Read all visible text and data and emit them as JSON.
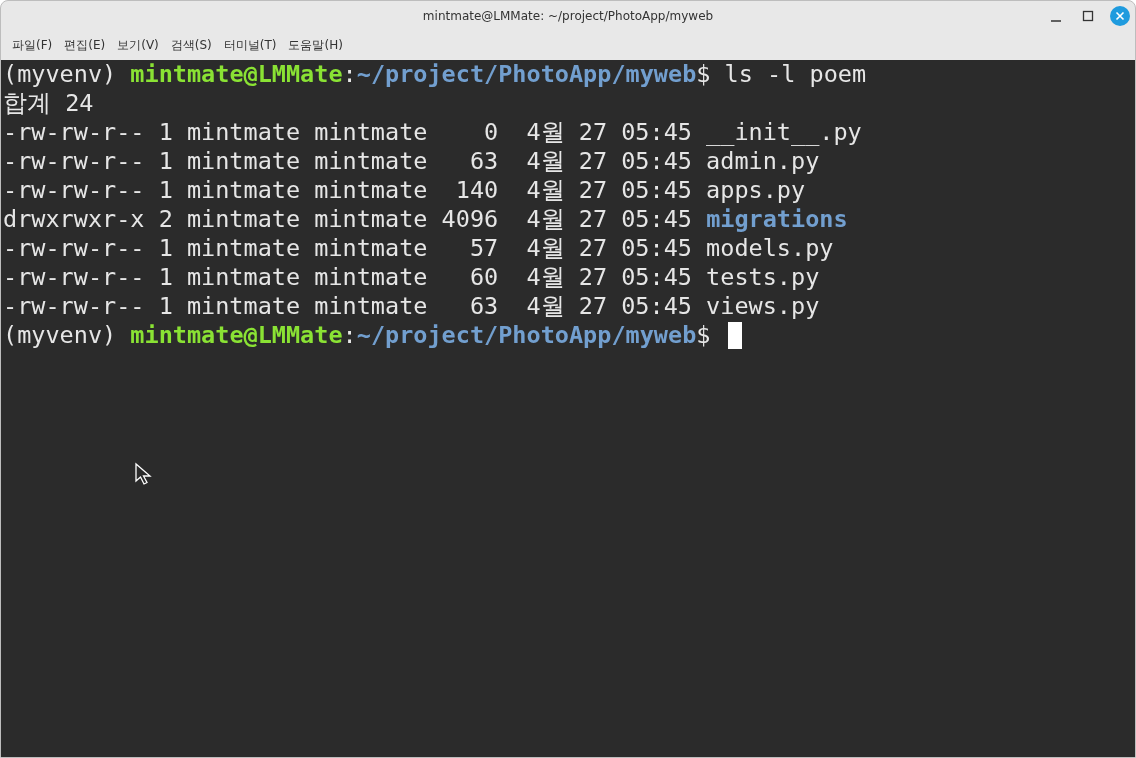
{
  "window": {
    "title": "mintmate@LMMate: ~/project/PhotoApp/myweb"
  },
  "menu": [
    {
      "label": "파일(F)"
    },
    {
      "label": "편집(E)"
    },
    {
      "label": "보기(V)"
    },
    {
      "label": "검색(S)"
    },
    {
      "label": "터미널(T)"
    },
    {
      "label": "도움말(H)"
    }
  ],
  "terminal": {
    "lines": [
      {
        "segments": [
          {
            "kind": "plain",
            "text": "(myvenv) "
          },
          {
            "kind": "user",
            "text": "mintmate@LMMate"
          },
          {
            "kind": "plain",
            "text": ":"
          },
          {
            "kind": "path",
            "text": "~/project/PhotoApp/myweb"
          },
          {
            "kind": "plain",
            "text": "$ ls -l poem"
          }
        ]
      },
      {
        "segments": [
          {
            "kind": "plain",
            "text": "합계 24"
          }
        ]
      },
      {
        "segments": [
          {
            "kind": "plain",
            "text": "-rw-rw-r-- 1 mintmate mintmate    0  4월 27 05:45 __init__.py"
          }
        ]
      },
      {
        "segments": [
          {
            "kind": "plain",
            "text": "-rw-rw-r-- 1 mintmate mintmate   63  4월 27 05:45 admin.py"
          }
        ]
      },
      {
        "segments": [
          {
            "kind": "plain",
            "text": "-rw-rw-r-- 1 mintmate mintmate  140  4월 27 05:45 apps.py"
          }
        ]
      },
      {
        "segments": [
          {
            "kind": "plain",
            "text": "drwxrwxr-x 2 mintmate mintmate 4096  4월 27 05:45 "
          },
          {
            "kind": "dir",
            "text": "migrations"
          }
        ]
      },
      {
        "segments": [
          {
            "kind": "plain",
            "text": "-rw-rw-r-- 1 mintmate mintmate   57  4월 27 05:45 models.py"
          }
        ]
      },
      {
        "segments": [
          {
            "kind": "plain",
            "text": "-rw-rw-r-- 1 mintmate mintmate   60  4월 27 05:45 tests.py"
          }
        ]
      },
      {
        "segments": [
          {
            "kind": "plain",
            "text": "-rw-rw-r-- 1 mintmate mintmate   63  4월 27 05:45 views.py"
          }
        ]
      },
      {
        "segments": [
          {
            "kind": "plain",
            "text": "(myvenv) "
          },
          {
            "kind": "user",
            "text": "mintmate@LMMate"
          },
          {
            "kind": "plain",
            "text": ":"
          },
          {
            "kind": "path",
            "text": "~/project/PhotoApp/myweb"
          },
          {
            "kind": "plain",
            "text": "$ "
          }
        ]
      }
    ]
  }
}
